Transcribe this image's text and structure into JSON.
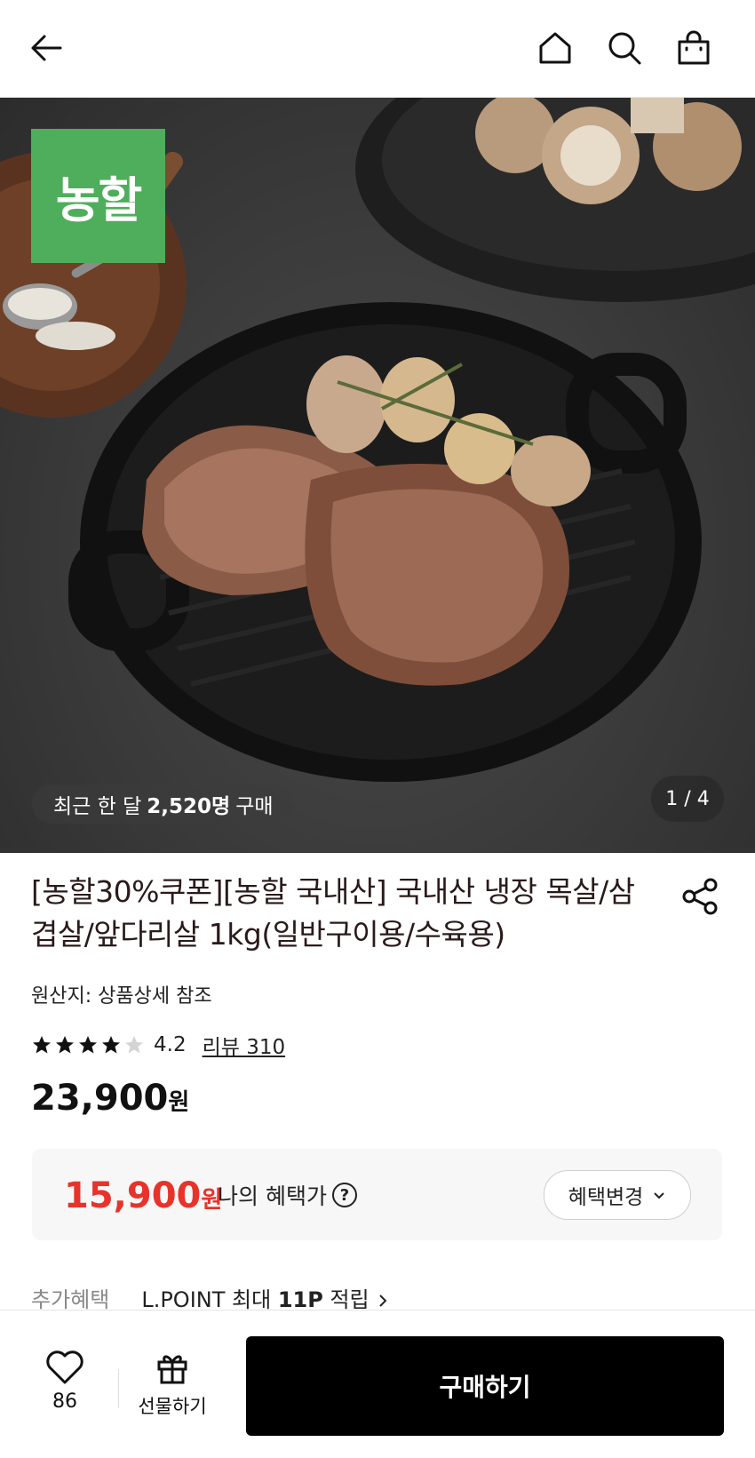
{
  "header": {
    "back_icon": "arrow-left-icon",
    "home_icon": "home-icon",
    "search_icon": "search-icon",
    "cart_icon": "shopping-bag-icon"
  },
  "hero": {
    "brand_logo_text": "농할",
    "brand_color": "#4fae5b",
    "purchase_prefix": "최근 한 달",
    "purchase_count": "2,520명",
    "purchase_suffix": "구매",
    "image_counter": "1 / 4"
  },
  "product": {
    "title": "[농할30%쿠폰][농할 국내산] 국내산 냉장 목살/삼겹살/앞다리살 1kg(일반구이용/수육용)",
    "origin": "원산지: 상품상세 참조",
    "rating": "4.2",
    "rating_stars_filled": 4,
    "review_label": "리뷰 310",
    "price": "23,900",
    "price_unit": "원"
  },
  "benefit": {
    "price": "15,900",
    "price_unit": "원",
    "label": "나의 혜택가",
    "help_icon": "question-circle-icon",
    "change_label": "혜택변경",
    "accent_color": "#e8332a"
  },
  "extra_benefit": {
    "key": "추가혜택",
    "value_prefix": "L.POINT 최대",
    "value_bold": "11P",
    "value_suffix": "적립"
  },
  "bottom_bar": {
    "like_count": "86",
    "gift_label": "선물하기",
    "buy_label": "구매하기"
  }
}
